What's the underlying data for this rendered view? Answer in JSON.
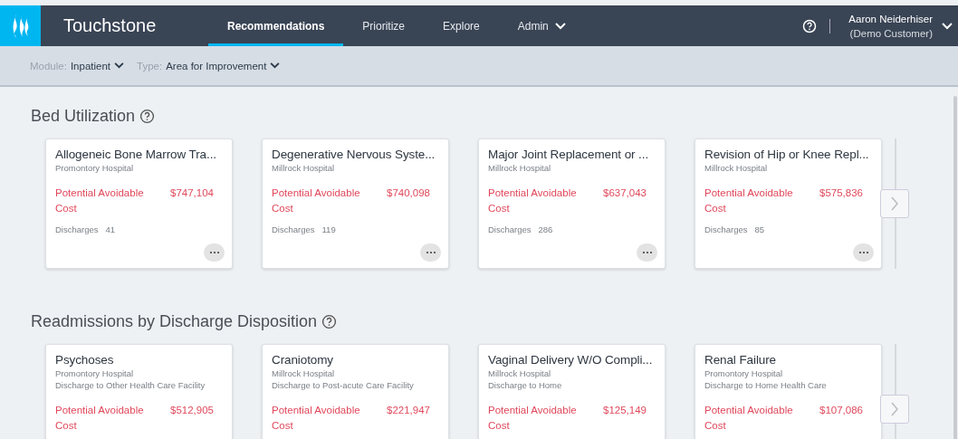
{
  "header": {
    "brand": "Touchstone",
    "nav": [
      {
        "label": "Recommendations",
        "selected": true,
        "dropdown": false
      },
      {
        "label": "Prioritize",
        "selected": false,
        "dropdown": false
      },
      {
        "label": "Explore",
        "selected": false,
        "dropdown": false
      },
      {
        "label": "Admin",
        "selected": false,
        "dropdown": true
      }
    ],
    "user": {
      "name": "Aaron Neiderhiser",
      "role": "(Demo Customer)"
    }
  },
  "filters": [
    {
      "label": "Module:",
      "value": "Inpatient"
    },
    {
      "label": "Type:",
      "value": "Area for Improvement"
    }
  ],
  "sections": [
    {
      "title": "Bed Utilization",
      "cards": [
        {
          "title": "Allogeneic Bone Marrow Tra...",
          "hospital": "Promontory Hospital",
          "metric": "Potential Avoidable Cost",
          "value": "$747,104",
          "discharges_label": "Discharges",
          "discharges": "41"
        },
        {
          "title": "Degenerative Nervous Syste...",
          "hospital": "Millrock Hospital",
          "metric": "Potential Avoidable Cost",
          "value": "$740,098",
          "discharges_label": "Discharges",
          "discharges": "119"
        },
        {
          "title": "Major Joint Replacement or ...",
          "hospital": "Millrock Hospital",
          "metric": "Potential Avoidable Cost",
          "value": "$637,043",
          "discharges_label": "Discharges",
          "discharges": "286"
        },
        {
          "title": "Revision of Hip or Knee Repl...",
          "hospital": "Millrock Hospital",
          "metric": "Potential Avoidable Cost",
          "value": "$575,836",
          "discharges_label": "Discharges",
          "discharges": "85"
        }
      ]
    },
    {
      "title": "Readmissions by Discharge Disposition",
      "cards": [
        {
          "title": "Psychoses",
          "hospital": "Promontory Hospital",
          "disposition": "Discharge to Other Health Care Facility",
          "metric": "Potential Avoidable Cost",
          "value": "$512,905"
        },
        {
          "title": "Craniotomy",
          "hospital": "Millrock Hospital",
          "disposition": "Discharge to Post-acute Care Facility",
          "metric": "Potential Avoidable Cost",
          "value": "$221,947"
        },
        {
          "title": "Vaginal Delivery W/O Compli...",
          "hospital": "Millrock Hospital",
          "disposition": "Discharge to Home",
          "metric": "Potential Avoidable Cost",
          "value": "$125,149"
        },
        {
          "title": "Renal Failure",
          "hospital": "Promontory Hospital",
          "disposition": "Discharge to Home Health Care",
          "metric": "Potential Avoidable Cost",
          "value": "$107,086"
        }
      ]
    }
  ]
}
